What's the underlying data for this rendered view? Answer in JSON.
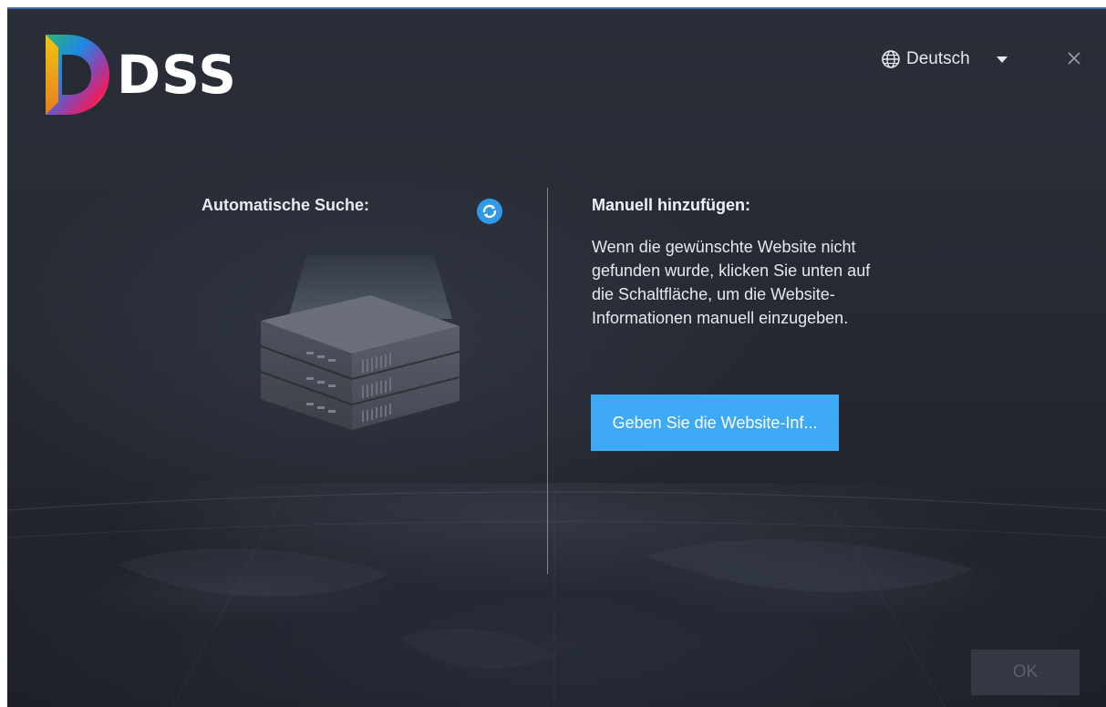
{
  "app": {
    "brand": "DSS"
  },
  "header": {
    "language": "Deutsch",
    "icons": [
      "globe-icon",
      "chevron-down-icon",
      "close-icon"
    ]
  },
  "auto_search": {
    "label": "Automatische Suche:",
    "refresh_icon": "refresh-icon",
    "illustration": "server-icon"
  },
  "manual": {
    "title": "Manuell hinzufügen:",
    "description": "Wenn die gewünschte Website nicht gefunden wurde, klicken Sie unten auf die Schaltfläche, um die Website-Informationen manuell einzugeben.",
    "button_label": "Geben Sie die Website-Inf..."
  },
  "footer": {
    "ok_label": "OK"
  },
  "colors": {
    "accent": "#3ea9f5",
    "background": "#262a33",
    "disabled_button": "#343842"
  }
}
